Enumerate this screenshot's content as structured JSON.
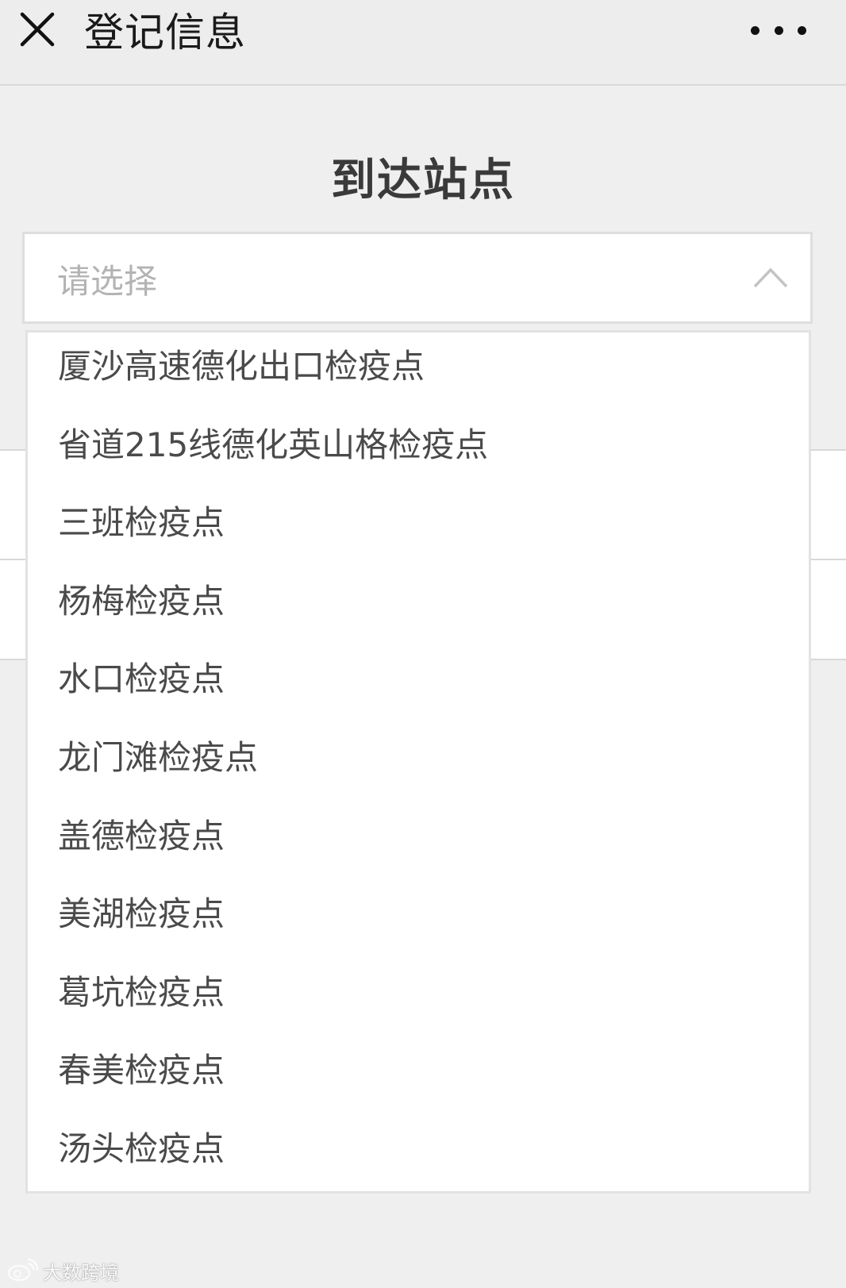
{
  "navbar": {
    "title": "登记信息",
    "close_icon": "close-icon",
    "more_icon": "more-icon"
  },
  "section": {
    "title": "到达站点"
  },
  "select": {
    "placeholder": "请选择",
    "chevron_icon": "chevron-up-icon"
  },
  "dropdown": {
    "options": [
      "厦沙高速德化出口检疫点",
      "省道215线德化英山格检疫点",
      "三班检疫点",
      "杨梅检疫点",
      "水口检疫点",
      "龙门滩检疫点",
      "盖德检疫点",
      "美湖检疫点",
      "葛坑检疫点",
      "春美检疫点",
      "汤头检疫点"
    ]
  },
  "watermark": {
    "text": "大数跨境"
  },
  "colors": {
    "background": "#efeff0",
    "navbar": "#ededed",
    "text": "#4a4a4a",
    "placeholder": "#b3b3b3"
  }
}
